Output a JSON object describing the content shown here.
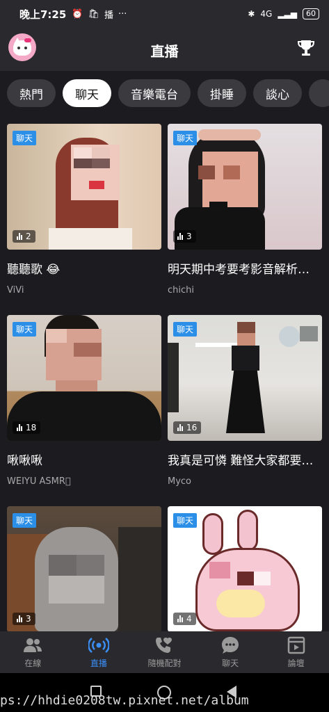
{
  "status_bar": {
    "time": "晚上7:25",
    "battery": "60",
    "network": "4G",
    "app_label": "播"
  },
  "header": {
    "title": "直播"
  },
  "tabs": [
    {
      "label": "熱門",
      "active": false
    },
    {
      "label": "聊天",
      "active": true
    },
    {
      "label": "音樂電台",
      "active": false
    },
    {
      "label": "掛睡",
      "active": false
    },
    {
      "label": "談心",
      "active": false
    }
  ],
  "cards": [
    {
      "badge": "聊天",
      "viewers": "2",
      "title": "聽聽歌 😂",
      "author": "ViVi"
    },
    {
      "badge": "聊天",
      "viewers": "3",
      "title": "明天期中考要考影音解析…",
      "author": "chichi"
    },
    {
      "badge": "聊天",
      "viewers": "18",
      "title": "啾啾啾",
      "author": "ẆEIYU ÀSMR⃝"
    },
    {
      "badge": "聊天",
      "viewers": "16",
      "title": "我真是可憐 難怪大家都要…",
      "author": "Myco"
    },
    {
      "badge": "聊天",
      "viewers": "3",
      "title": "",
      "author": ""
    },
    {
      "badge": "聊天",
      "viewers": "4",
      "title": "",
      "author": ""
    }
  ],
  "bottom_nav": [
    {
      "label": "在線",
      "icon": "people-icon",
      "active": false
    },
    {
      "label": "直播",
      "icon": "broadcast-icon",
      "active": true
    },
    {
      "label": "隨機配對",
      "icon": "heart-phone-icon",
      "active": false
    },
    {
      "label": "聊天",
      "icon": "chat-bubble-icon",
      "active": false
    },
    {
      "label": "論壇",
      "icon": "forum-icon",
      "active": false
    }
  ],
  "watermark": "ps://hhdie0208tw.pixnet.net/album",
  "colors": {
    "accent": "#3a8ef6",
    "badge": "#2b8fe8",
    "background": "#1c1c20",
    "bar": "#2a2a2e"
  }
}
